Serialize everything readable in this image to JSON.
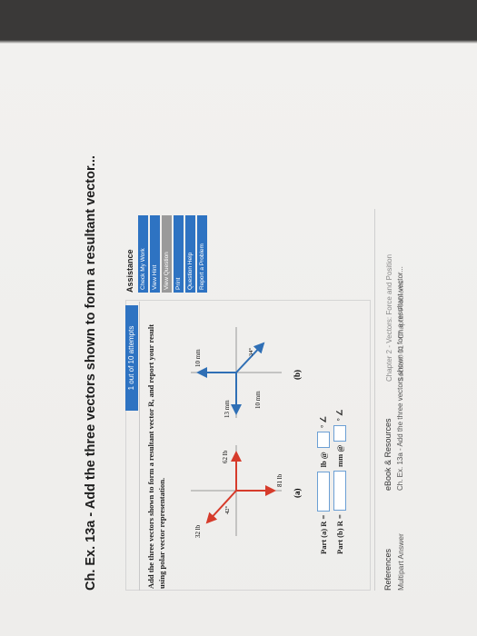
{
  "title": "Ch. Ex. 13a - Add the three vectors shown to form a resultant vector...",
  "attempts": "1 out of 10 attempts",
  "prompt": {
    "text": "Add the three vectors shown to form a resultant vector R, and report your result using polar vector representation."
  },
  "figure_a": {
    "label": "(a)",
    "forces": [
      "32 lb",
      "62 lb",
      "81 lb"
    ],
    "angle": "42°"
  },
  "figure_b": {
    "label": "(b)",
    "forces": [
      "13 mm",
      "10 mm",
      "10 mm"
    ],
    "angle": "34°"
  },
  "answers": {
    "part_a_label": "Part (a) R =",
    "part_a_unit": "lb @",
    "part_b_label": "Part (b) R =",
    "part_b_unit": "mm @",
    "degree_symbol": "° ∠"
  },
  "assistance": {
    "title": "Assistance",
    "buttons": [
      "Check My Work",
      "View Hint",
      "View Question",
      "Print",
      "Question Help",
      "Report a Problem"
    ]
  },
  "references": {
    "label": "References",
    "ebook": "eBook & Resources",
    "chapter": "Chapter 2 - Vectors: Force and Position",
    "type_label": "Multipart Answer",
    "section": "Section: 01 - Chapter Problems",
    "exercise": "Ch. Ex. 13a - Add the three vectors shown to form a resultant vector..."
  }
}
